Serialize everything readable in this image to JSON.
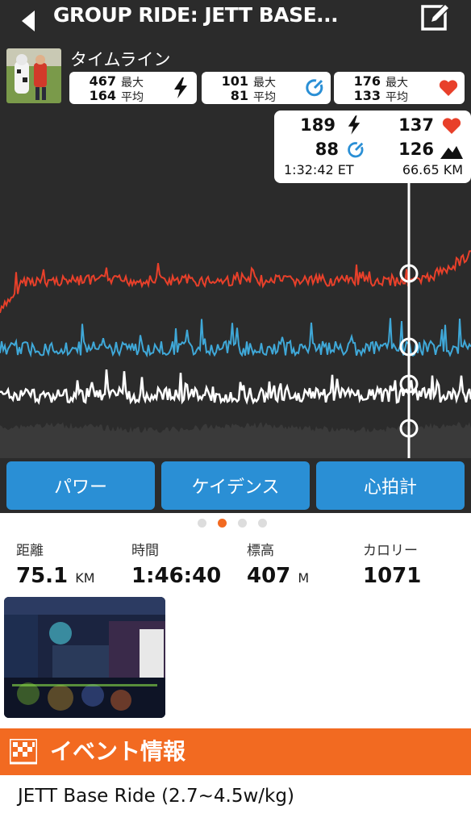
{
  "header": {
    "title": "GROUP RIDE: JETT BASE..."
  },
  "timeline_label": "タイムライン",
  "stats": [
    {
      "max": "467",
      "avg": "164",
      "max_label": "最大",
      "avg_label": "平均",
      "icon": "lightning-icon"
    },
    {
      "max": "101",
      "avg": "81",
      "max_label": "最大",
      "avg_label": "平均",
      "icon": "cadence-icon"
    },
    {
      "max": "176",
      "avg": "133",
      "max_label": "最大",
      "avg_label": "平均",
      "icon": "heart-icon"
    }
  ],
  "tooltip": {
    "power": "189",
    "heart_rate": "137",
    "cadence": "88",
    "elevation": "126",
    "elapsed": "1:32:42 ET",
    "distance": "66.65 KM"
  },
  "colors": {
    "power": "#ffffff",
    "cadence": "#3fa8d8",
    "heart": "#e8402a",
    "button": "#2a8fd5",
    "accent": "#f26a21"
  },
  "tabs": {
    "power": "パワー",
    "cadence": "ケイデンス",
    "heart": "心拍計"
  },
  "pager": {
    "count": 4,
    "active": 1
  },
  "metrics": [
    {
      "label": "距離",
      "value": "75.1",
      "unit": "KM"
    },
    {
      "label": "時間",
      "value": "1:46:40",
      "unit": ""
    },
    {
      "label": "標高",
      "value": "407",
      "unit": "M"
    },
    {
      "label": "カロリー",
      "value": "1071",
      "unit": ""
    }
  ],
  "event": {
    "section_title": "イベント情報",
    "name": "JETT Base Ride (2.7~4.5w/kg)"
  }
}
